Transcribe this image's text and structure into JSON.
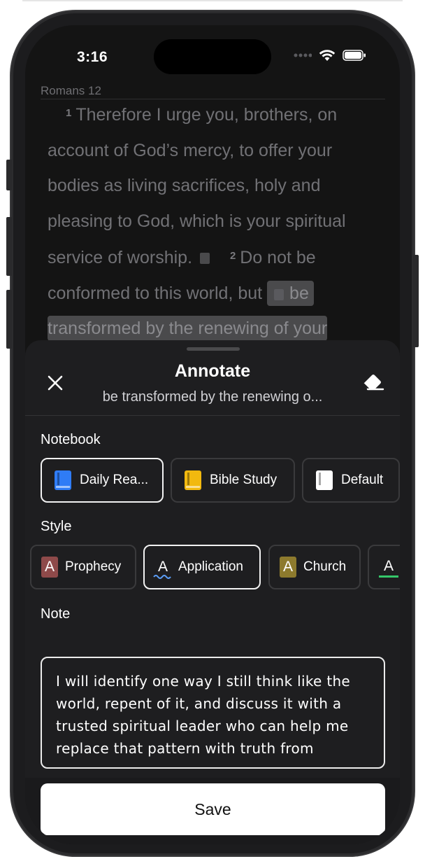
{
  "status_bar": {
    "time": "3:16"
  },
  "reader": {
    "chapter": "Romans 12",
    "verse1_num": "1",
    "verse1_text": "Therefore I urge you, brothers, on account of God’s mercy, to offer your bodies as living sacrifices, holy and pleasing to God, which is your spiritual service of worship.",
    "verse2_num": "2",
    "verse2_plain": "Do not be conformed to this world, but",
    "verse2_hl_1": "be",
    "verse2_hl_2": "transformed by the renewing of your"
  },
  "sheet": {
    "title": "Annotate",
    "subtitle": "be transformed by the renewing o...",
    "notebook_label": "Notebook",
    "notebooks": [
      {
        "label": "Daily Rea...",
        "color": "#2f7cf6",
        "selected": true
      },
      {
        "label": "Bible Study",
        "color": "#f2b90f",
        "selected": false
      },
      {
        "label": "Default",
        "color": "#ffffff",
        "selected": false
      }
    ],
    "style_label": "Style",
    "styles": [
      {
        "label": "Prophecy",
        "glyph": "A",
        "color": "#8e4a4a",
        "kind": "fill",
        "selected": false
      },
      {
        "label": "Application",
        "glyph": "A",
        "color": "#5b9df5",
        "kind": "wavy",
        "selected": true
      },
      {
        "label": "Church",
        "glyph": "A",
        "color": "#8d7a2d",
        "kind": "fill",
        "selected": false
      },
      {
        "label": "",
        "glyph": "A",
        "color": "#35c76a",
        "kind": "underline",
        "selected": false
      }
    ],
    "note_label": "Note",
    "note_text": "I will identify one way I still think like the world, repent of it, and discuss it with a trusted spiritual leader who can help me replace that pattern with truth from",
    "save_label": "Save"
  },
  "icons": {
    "close": "close-icon",
    "eraser": "eraser-icon",
    "wifi": "wifi-icon",
    "battery": "battery-icon",
    "signal": "signal-dots-icon",
    "book": "book-icon",
    "note": "note-icon",
    "copy": "copy-icon"
  }
}
